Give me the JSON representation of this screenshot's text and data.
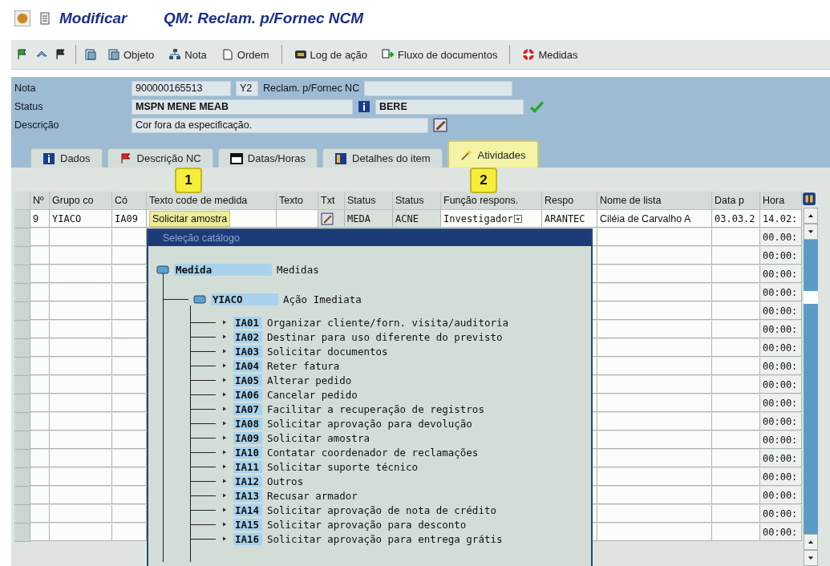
{
  "title_bar": {
    "mode": "Modificar",
    "title": "QM: Reclam. p/Fornec NCM"
  },
  "toolbar": [
    {
      "kind": "icon"
    },
    {
      "kind": "icon"
    },
    {
      "kind": "icon"
    },
    {
      "kind": "separator"
    },
    {
      "kind": "icon"
    },
    {
      "kind": "button",
      "label": "Objeto"
    },
    {
      "kind": "button",
      "label": "Nota"
    },
    {
      "kind": "button",
      "label": "Ordem"
    },
    {
      "kind": "separator"
    },
    {
      "kind": "button",
      "label": "Log de ação"
    },
    {
      "kind": "button",
      "label": "Fluxo de documentos"
    },
    {
      "kind": "separator"
    },
    {
      "kind": "button",
      "label": "Medidas"
    }
  ],
  "header": {
    "nota_label": "Nota",
    "nota": "900000165513",
    "tipo": "Y2",
    "tipo_text": "Reclam. p/Fornec NC",
    "status_label": "Status",
    "status": "MSPN MENE MEAB",
    "status_user": "BERE",
    "descricao_label": "Descrição",
    "descricao": "Cor fora da especificação."
  },
  "tabs": [
    {
      "label": "Dados",
      "selected": false
    },
    {
      "label": "Descrição NC",
      "selected": false
    },
    {
      "label": "Datas/Horas",
      "selected": false
    },
    {
      "label": "Detalhes do item",
      "selected": false
    },
    {
      "label": "Atividades",
      "selected": true
    }
  ],
  "table": {
    "columns": [
      "Nº",
      "Grupo co",
      "Có",
      "Texto code de medida",
      "Texto",
      "Txt",
      "Status",
      "Status",
      "Função respons.",
      "Respo",
      "Nome de lista",
      "Data p",
      "Hora"
    ],
    "rows": [
      {
        "cells": [
          {
            "kind": "text",
            "text": "9"
          },
          {
            "kind": "text",
            "text": "YIACO"
          },
          {
            "kind": "text",
            "text": "IA09"
          },
          {
            "kind": "highlight",
            "text": "Solicitar amostra"
          },
          {
            "kind": "empty"
          },
          {
            "kind": "edit"
          },
          {
            "kind": "text",
            "text": "MEDA"
          },
          {
            "kind": "text",
            "text": "ACNE"
          },
          {
            "kind": "dropdown",
            "text": "Investigador"
          },
          {
            "kind": "text",
            "text": "ARANTEC"
          },
          {
            "kind": "text",
            "text": "Ciléia de Carvalho A"
          },
          {
            "kind": "text",
            "text": "03.03.2"
          },
          {
            "kind": "text",
            "text": "14.02:"
          }
        ]
      },
      {
        "hora": "00.00:"
      },
      {
        "hora": "00:00:"
      },
      {
        "hora": "00:00:"
      },
      {
        "hora": "00:00:"
      },
      {
        "hora": "00:00:"
      },
      {
        "hora": "00:00:"
      },
      {
        "hora": "00:00:"
      },
      {
        "hora": "00:00:"
      },
      {
        "hora": "00:00:"
      },
      {
        "hora": "00:00:"
      },
      {
        "hora": "00:00:"
      },
      {
        "hora": "00:00:"
      },
      {
        "hora": "00:00:"
      },
      {
        "hora": "00:00:"
      },
      {
        "hora": "00:00:"
      },
      {
        "hora": "00:00:"
      },
      {
        "hora": "00:00:"
      }
    ]
  },
  "callouts": [
    {
      "label": "1"
    },
    {
      "label": "2"
    }
  ],
  "dialog": {
    "title": "Seleção catálogo",
    "tree": {
      "code": "Medida",
      "text": "Medidas",
      "children": [
        {
          "code": "YIACO",
          "text": "Ação Imediata",
          "children": [
            {
              "code": "IA01",
              "text": "Organizar cliente/forn. visita/auditoria"
            },
            {
              "code": "IA02",
              "text": "Destinar para uso diferente do previsto"
            },
            {
              "code": "IA03",
              "text": "Solicitar documentos"
            },
            {
              "code": "IA04",
              "text": "Reter fatura"
            },
            {
              "code": "IA05",
              "text": "Alterar pedido"
            },
            {
              "code": "IA06",
              "text": "Cancelar pedido"
            },
            {
              "code": "IA07",
              "text": "Facilitar a recuperação de registros"
            },
            {
              "code": "IA08",
              "text": "Solicitar aprovação para devolução"
            },
            {
              "code": "IA09",
              "text": "Solicitar amostra"
            },
            {
              "code": "IA10",
              "text": "Contatar coordenador de reclamações"
            },
            {
              "code": "IA11",
              "text": "Solicitar suporte técnico"
            },
            {
              "code": "IA12",
              "text": "Outros"
            },
            {
              "code": "IA13",
              "text": "Recusar armador"
            },
            {
              "code": "IA14",
              "text": "Solicitar aprovação de nota de crédito"
            },
            {
              "code": "IA15",
              "text": "Solicitar aprovação para desconto"
            },
            {
              "code": "IA16",
              "text": "Solicitar aprovação para entrega grátis"
            }
          ]
        }
      ]
    }
  }
}
